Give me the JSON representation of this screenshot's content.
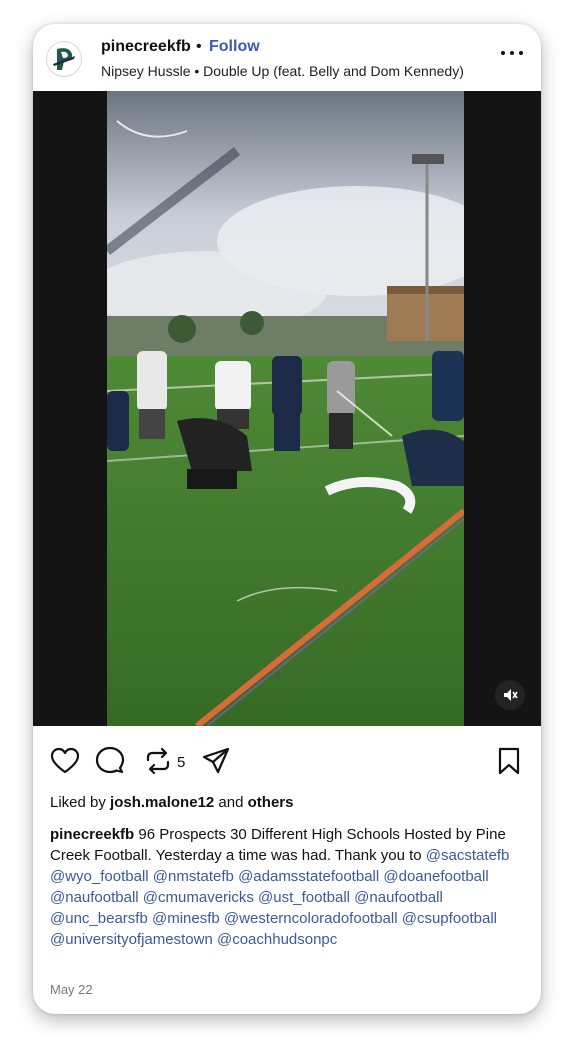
{
  "post": {
    "username": "pinecreekfb",
    "separator": "•",
    "follow_label": "Follow",
    "audio": "Nipsey Hussle • Double Up (feat. Belly and Dom Kennedy)"
  },
  "actions": {
    "repost_count": "5"
  },
  "likes": {
    "prefix": "Liked by",
    "user": "josh.malone12",
    "conjunction": "and",
    "others": "others"
  },
  "caption": {
    "user": "pinecreekfb",
    "text": "96 Prospects 30 Different High Schools Hosted by Pine Creek Football. Yesterday a time was had. Thank you to",
    "tags": [
      "@sacstatefb",
      "@wyo_football",
      "@nmstatefb",
      "@adamsstatefootball",
      "@doanefootball",
      "@naufootball",
      "@cmumavericks",
      "@ust_football",
      "@naufootball",
      "@unc_bearsfb",
      "@minesfb",
      "@westerncoloradofootball",
      "@csupfootball",
      "@universityofjamestown",
      "@coachhudsonpc"
    ]
  },
  "date": "May 22",
  "colors": {
    "link": "#3b5a9d",
    "follow": "#3b5bb5",
    "field": "#3f7a2e"
  },
  "icons": [
    "heart-icon",
    "comment-icon",
    "repost-icon",
    "share-icon",
    "bookmark-icon",
    "more-icon",
    "mute-icon"
  ]
}
